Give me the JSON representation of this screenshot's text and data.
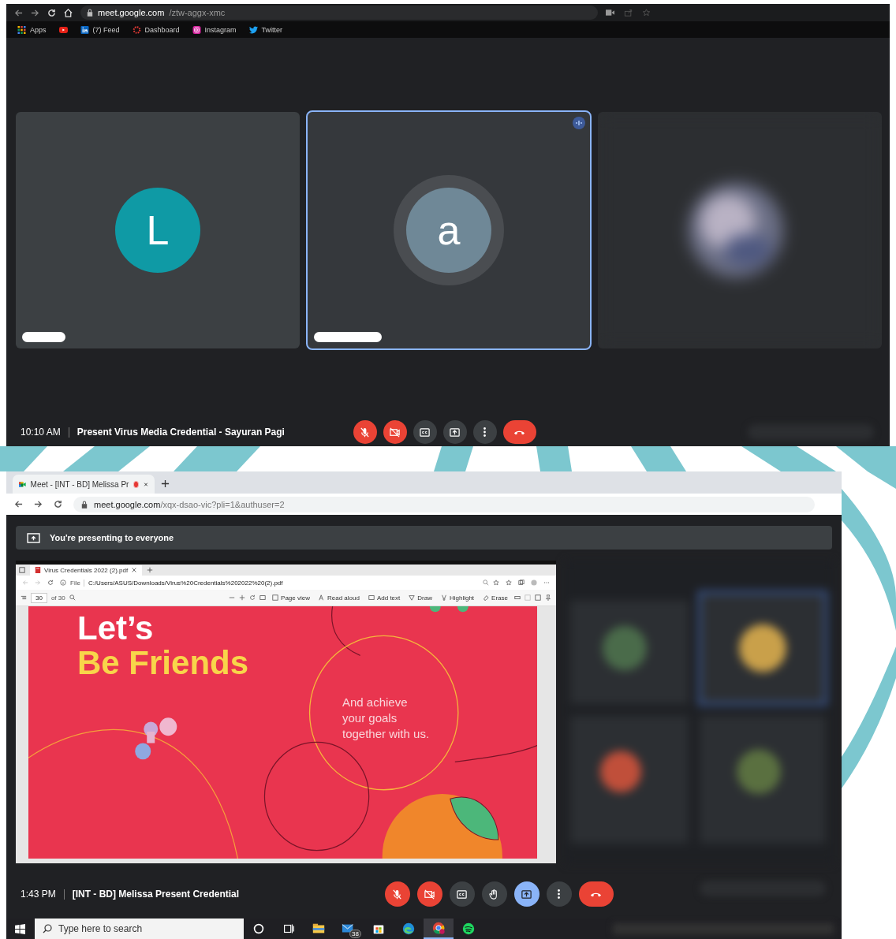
{
  "top_screenshot": {
    "browser": {
      "url_host": "meet.google.com",
      "url_path": "/ztw-aggx-xmc",
      "bookmarks": [
        {
          "kind": "apps",
          "label": "Apps"
        },
        {
          "kind": "youtube"
        },
        {
          "kind": "linkedin",
          "label": "(7) Feed"
        },
        {
          "kind": "dashboard",
          "label": "Dashboard"
        },
        {
          "kind": "instagram",
          "label": "Instagram"
        },
        {
          "kind": "twitter",
          "label": "Twitter"
        }
      ]
    },
    "tiles": [
      {
        "kind": "avatar",
        "initial": "L",
        "color": "#0f9aa5",
        "selected": false
      },
      {
        "kind": "avatar",
        "initial": "a",
        "color": "#6f8897",
        "selected": true
      },
      {
        "kind": "blurred",
        "selected": false
      }
    ],
    "meeting_bar": {
      "time": "10:10 AM",
      "title": "Present Virus Media Credential - Sayuran Pagi",
      "buttons": [
        {
          "kind": "mic-off",
          "color": "#ea4335"
        },
        {
          "kind": "camera-off",
          "color": "#ea4335"
        },
        {
          "kind": "captions",
          "color": "#3c4043"
        },
        {
          "kind": "present",
          "color": "#3c4043"
        },
        {
          "kind": "more",
          "color": "#3c4043"
        },
        {
          "kind": "hang-up",
          "color": "#ea4335"
        }
      ]
    }
  },
  "bottom_screenshot": {
    "browser": {
      "tab_title": "Meet - [INT - BD] Melissa Pr",
      "recording": true,
      "url_host": "meet.google.com",
      "url_path": "/xqx-dsao-vic?pli=1&authuser=2"
    },
    "banner": "You're presenting to everyone",
    "pdf_viewer": {
      "tab_title": "Virus Credentials 2022 (2).pdf",
      "file_label": "File",
      "path": "C:/Users/ASUS/Downloads/Virus%20Credentials%202022%20(2).pdf",
      "page": "30",
      "page_count": "of 30",
      "tools": [
        {
          "kind": "page-view",
          "label": "Page view"
        },
        {
          "kind": "read-aloud",
          "label": "Read aloud"
        },
        {
          "kind": "add-text",
          "label": "Add text"
        },
        {
          "kind": "draw",
          "label": "Draw"
        },
        {
          "kind": "highlight",
          "label": "Highlight"
        },
        {
          "kind": "erase",
          "label": "Erase"
        }
      ]
    },
    "slide": {
      "title_lines": [
        "Let’s",
        "Be Friends"
      ],
      "body_lines": [
        "And achieve",
        "your goals",
        "together with us."
      ]
    },
    "meeting_bar": {
      "time": "1:43 PM",
      "title": "[INT - BD] Melissa Present Credential",
      "buttons": [
        {
          "kind": "mic-off",
          "color": "#ea4335"
        },
        {
          "kind": "camera-off",
          "color": "#ea4335"
        },
        {
          "kind": "captions",
          "color": "#3c4043"
        },
        {
          "kind": "raise-hand",
          "color": "#3c4043"
        },
        {
          "kind": "present",
          "color": "#8ab4f8"
        },
        {
          "kind": "more",
          "color": "#3c4043"
        },
        {
          "kind": "hang-up",
          "color": "#ea4335"
        }
      ]
    },
    "taskbar": {
      "search_placeholder": "Type here to search",
      "apps": [
        {
          "kind": "cortana"
        },
        {
          "kind": "task-view"
        },
        {
          "kind": "file-explorer"
        },
        {
          "kind": "mail",
          "badge": "38"
        },
        {
          "kind": "store"
        },
        {
          "kind": "edge"
        },
        {
          "kind": "chrome",
          "selected": true
        },
        {
          "kind": "spotify"
        }
      ]
    }
  }
}
